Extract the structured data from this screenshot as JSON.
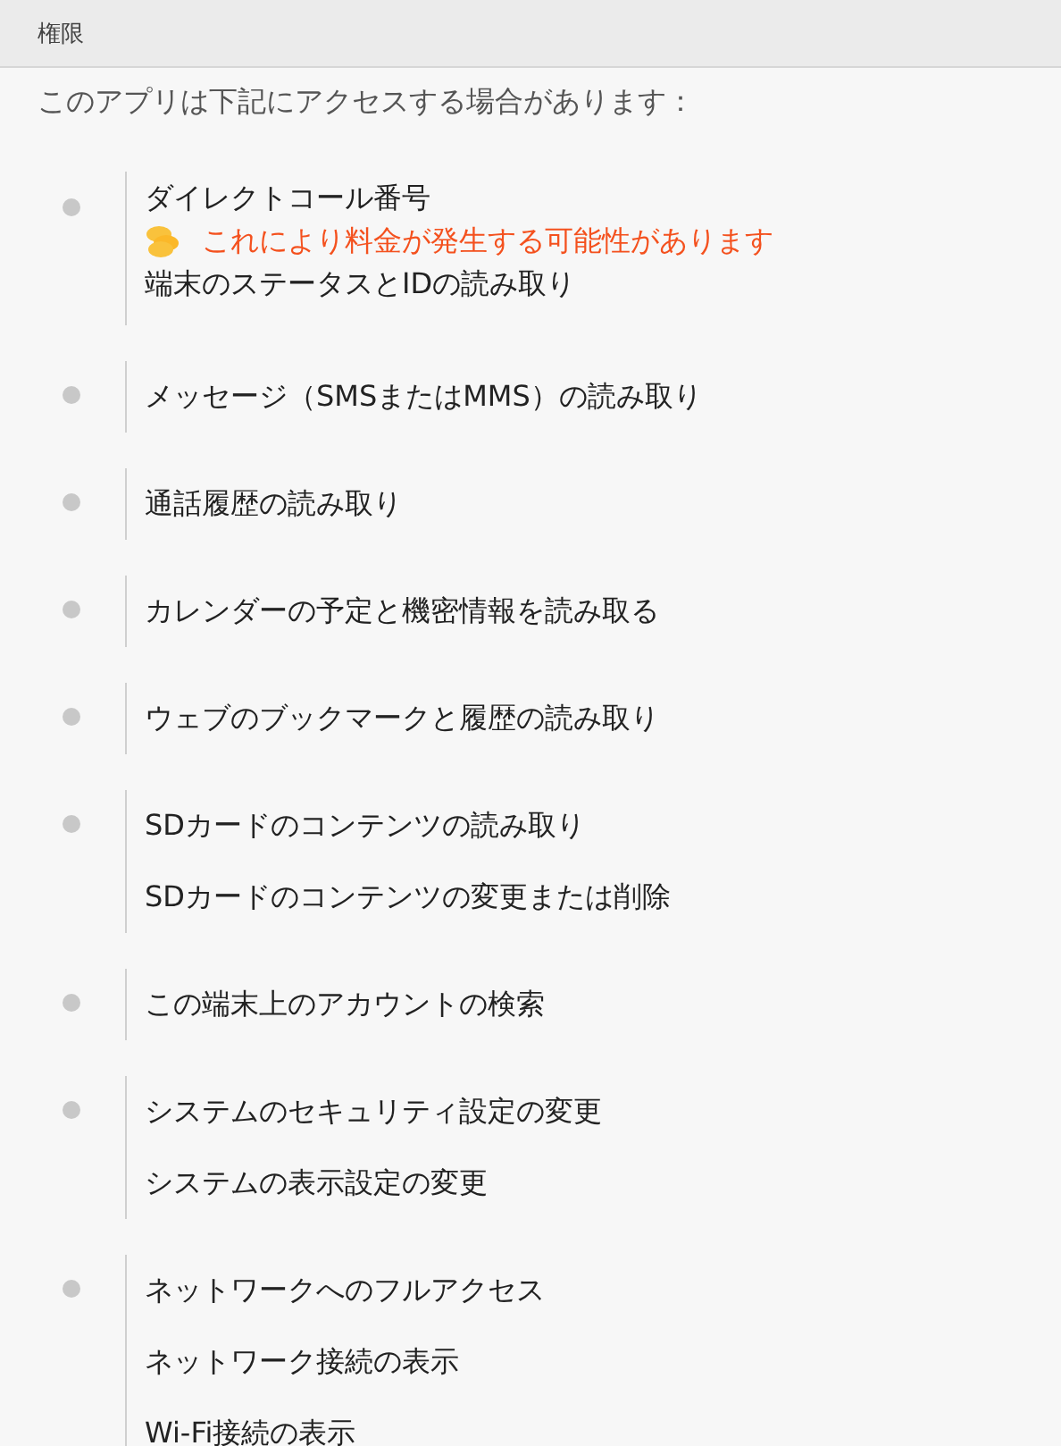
{
  "header": {
    "title": "権限"
  },
  "intro": "このアプリは下記にアクセスする場合があります：",
  "groups": [
    {
      "items": [
        {
          "kind": "permission",
          "text": "ダイレクトコール番号"
        },
        {
          "kind": "warning",
          "text": "これにより料金が発生する可能性があります"
        },
        {
          "kind": "permission",
          "text": "端末のステータスとIDの読み取り"
        }
      ]
    },
    {
      "items": [
        {
          "kind": "permission",
          "text": "メッセージ（SMSまたはMMS）の読み取り"
        }
      ]
    },
    {
      "items": [
        {
          "kind": "permission",
          "text": "通話履歴の読み取り"
        }
      ]
    },
    {
      "items": [
        {
          "kind": "permission",
          "text": "カレンダーの予定と機密情報を読み取る"
        }
      ]
    },
    {
      "items": [
        {
          "kind": "permission",
          "text": "ウェブのブックマークと履歴の読み取り"
        }
      ]
    },
    {
      "items": [
        {
          "kind": "permission",
          "text": "SDカードのコンテンツの読み取り"
        },
        {
          "kind": "permission",
          "text": "SDカードのコンテンツの変更または削除"
        }
      ]
    },
    {
      "items": [
        {
          "kind": "permission",
          "text": "この端末上のアカウントの検索"
        }
      ]
    },
    {
      "items": [
        {
          "kind": "permission",
          "text": "システムのセキュリティ設定の変更"
        },
        {
          "kind": "permission",
          "text": "システムの表示設定の変更"
        }
      ]
    },
    {
      "items": [
        {
          "kind": "permission",
          "text": "ネットワークへのフルアクセス"
        },
        {
          "kind": "permission",
          "text": "ネットワーク接続の表示"
        },
        {
          "kind": "permission",
          "text": "Wi-Fi接続の表示"
        }
      ]
    }
  ]
}
